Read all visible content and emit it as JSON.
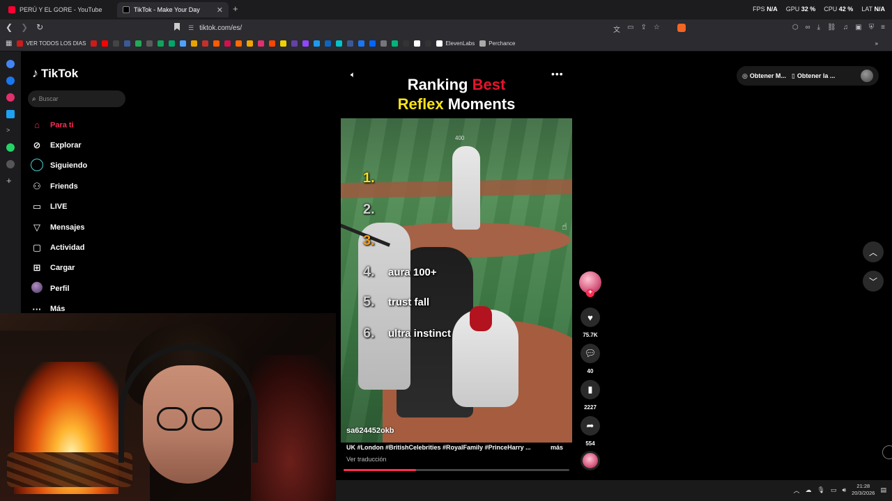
{
  "browser": {
    "tabs": [
      {
        "title": "PERÚ Y EL GORE - YouTube"
      },
      {
        "title": "TikTok - Make Your Day"
      }
    ],
    "url": "tiktok.com/es/",
    "perf": {
      "fps_label": "FPS",
      "fps": "N/A",
      "gpu_label": "GPU",
      "gpu": "32 %",
      "cpu_label": "CPU",
      "cpu": "42 %",
      "lat_label": "LAT",
      "lat": "N/A"
    },
    "bookmarks": {
      "first_label": "VER TODOS LOS DIAS",
      "elevenlabs": "ElevenLabs",
      "perchance": "Perchance"
    },
    "bookmark_colors": [
      "#cc1b1b",
      "#ff0000",
      "#444",
      "#3b5998",
      "#22aa55",
      "#5a5a5a",
      "#12a35a",
      "#00a86b",
      "#4da3ff",
      "#e8a200",
      "#c4302b",
      "#ff5a00",
      "#d50e4e",
      "#ff6a00",
      "#f0a500",
      "#e1306c",
      "#ff4500",
      "#f0d000",
      "#6441a5",
      "#9146ff",
      "#1d9bf0",
      "#0a66c2",
      "#00c4cc",
      "#3b5998",
      "#1877f2",
      "#0066ff",
      "#777",
      "#00b67a",
      "#333",
      "#fff",
      "#333"
    ]
  },
  "tiktok": {
    "logo": "TikTok",
    "search_placeholder": "Buscar",
    "nav": [
      {
        "label": "Para ti",
        "icon": "home-icon",
        "active": true
      },
      {
        "label": "Explorar",
        "icon": "compass-icon"
      },
      {
        "label": "Siguiendo",
        "icon": "following-ring-icon"
      },
      {
        "label": "Friends",
        "icon": "friends-icon"
      },
      {
        "label": "LIVE",
        "icon": "live-tv-icon"
      },
      {
        "label": "Mensajes",
        "icon": "messages-icon"
      },
      {
        "label": "Actividad",
        "icon": "activity-icon"
      },
      {
        "label": "Cargar",
        "icon": "upload-icon"
      },
      {
        "label": "Perfil",
        "icon": "profile-avatar-icon"
      },
      {
        "label": "Más",
        "icon": "more-dots-icon"
      }
    ],
    "top_pills": {
      "pill1": "Obtener M...",
      "pill2": "Obtener la ..."
    },
    "video": {
      "title_line1_a": "Ranking",
      "title_line1_b": "Best",
      "title_line2_a": "Reflex",
      "title_line2_b": "Moments",
      "sign": "400",
      "ranks": [
        {
          "n": "1.",
          "label": ""
        },
        {
          "n": "2.",
          "label": ""
        },
        {
          "n": "3.",
          "label": ""
        },
        {
          "n": "4.",
          "label": "aura 100+"
        },
        {
          "n": "5.",
          "label": "trust fall"
        },
        {
          "n": "6.",
          "label": "ultra instinct"
        }
      ],
      "author": "sa624452okb",
      "caption": "UK #London #BritishCelebrities #RoyalFamily #PrinceHarry ...",
      "more_label": "más",
      "translate": "Ver traducción",
      "progress": 0.32
    },
    "actions": {
      "likes": "75.7K",
      "comments": "40",
      "saves": "2227",
      "shares": "554"
    },
    "colors": {
      "accent": "#fe2c55",
      "title_red": "#e8132c",
      "title_yellow": "#f7e21b"
    }
  },
  "taskbar": {
    "time": "21:28",
    "date": "20/3/2026"
  }
}
